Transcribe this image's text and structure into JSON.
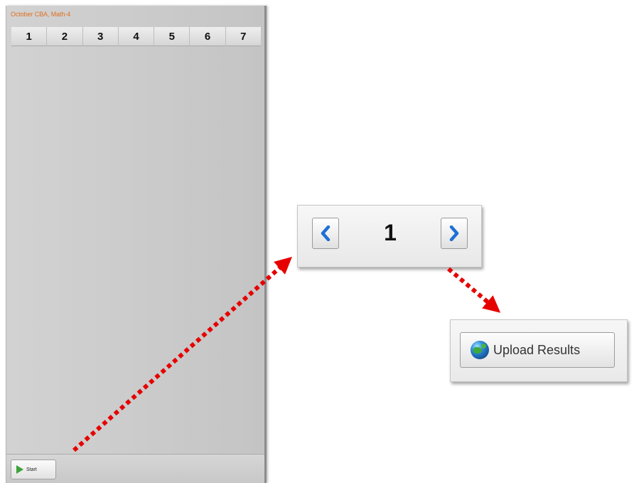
{
  "panel": {
    "title": "October CBA, Math-4",
    "tabs": [
      "1",
      "2",
      "3",
      "4",
      "5",
      "6",
      "7"
    ],
    "start_label": "Start",
    "start_icon": "play-icon"
  },
  "pager": {
    "current_page": "1",
    "prev_icon": "chevron-left-icon",
    "next_icon": "chevron-right-icon"
  },
  "upload": {
    "label": "Upload Results",
    "icon": "globe-icon"
  },
  "colors": {
    "title_orange": "#e07020",
    "arrow_red": "#e60000",
    "chevron_blue": "#1e6fd6",
    "play_green": "#3aa23a"
  }
}
